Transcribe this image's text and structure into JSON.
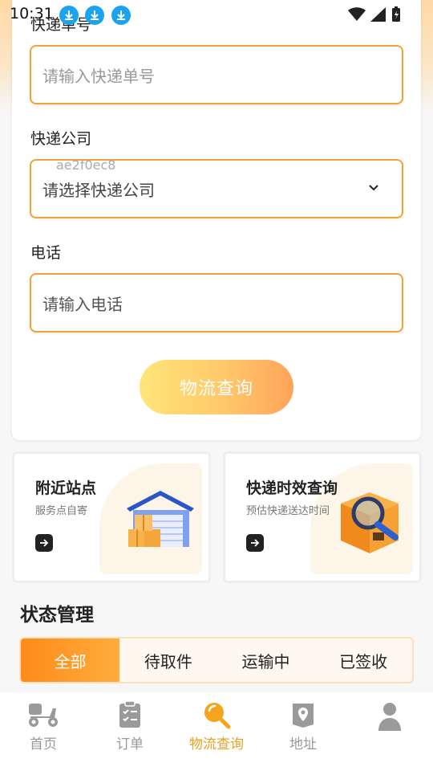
{
  "status_bar": {
    "time": "10:31"
  },
  "form": {
    "tracking_label": "快递单号",
    "tracking_placeholder": "请输入快递单号",
    "company_label": "快递公司",
    "company_placeholder": "请选择快递公司",
    "company_hint": "ae2f0ec8",
    "phone_label": "电话",
    "phone_placeholder": "请输入电话",
    "submit_label": "物流查询"
  },
  "features": [
    {
      "title": "附近站点",
      "subtitle": "服务点自寄"
    },
    {
      "title": "快递时效查询",
      "subtitle": "预估快递送达时间"
    }
  ],
  "status_section": {
    "title": "状态管理",
    "tabs": [
      "全部",
      "待取件",
      "运输中",
      "已签收"
    ],
    "active_tab": "全部"
  },
  "bottom_nav": {
    "items": [
      {
        "label": "首页",
        "icon": "scooter-icon"
      },
      {
        "label": "订单",
        "icon": "clipboard-check-icon"
      },
      {
        "label": "物流查询",
        "icon": "magnifier-icon"
      },
      {
        "label": "地址",
        "icon": "map-pin-icon"
      },
      {
        "label": "",
        "icon": "person-icon"
      }
    ],
    "active": "物流查询"
  },
  "colors": {
    "accent": "#f0a33a",
    "active_nav": "#e9a21f",
    "tab_active": "#ff8b1a",
    "download_badge": "#1aa3ee"
  }
}
